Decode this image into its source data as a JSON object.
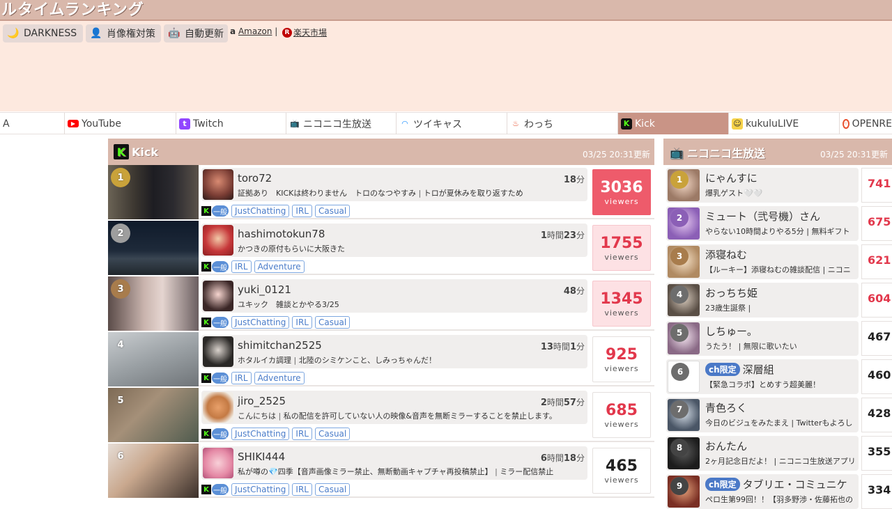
{
  "header": {
    "title": "ルタイムランキング",
    "buttons": [
      {
        "label": "DARKNESS",
        "icon": "moon-icon"
      },
      {
        "label": "肖像権対策",
        "icon": "portrait-icon"
      },
      {
        "label": "自動更新",
        "icon": "robot-icon"
      }
    ],
    "amazon": "Amazon",
    "separator": "|",
    "rakuten": "楽天市場",
    "amazon_mark": "a",
    "rakuten_mark": "R"
  },
  "tabs": [
    {
      "label": "A",
      "icon": ""
    },
    {
      "label": "YouTube",
      "icon": "youtube-icon"
    },
    {
      "label": "Twitch",
      "icon": "twitch-icon"
    },
    {
      "label": "ニコニコ生放送",
      "icon": "niconico-icon"
    },
    {
      "label": "ツイキャス",
      "icon": "twitcasting-icon"
    },
    {
      "label": "わっち",
      "icon": "watch-icon"
    },
    {
      "label": "Kick",
      "icon": "kick-icon"
    },
    {
      "label": "kukuluLIVE",
      "icon": "kukulu-icon"
    },
    {
      "label": "OPENRE",
      "icon": "openrec-icon"
    }
  ],
  "kick_panel": {
    "title": "Kick",
    "updated": "03/25 20:31更新",
    "general_label": "一般",
    "viewers_label": "viewers",
    "rows": [
      {
        "rank": "1",
        "name": "toro72",
        "desc": "証拠あり　KICKは終わりません　トロのなつやすみ",
        "desc2": "トロが夏休みを取り返すため",
        "duration_num": "18",
        "duration_unit": "分",
        "duration_num2": "",
        "duration_unit2": "",
        "tags": [
          "JustChatting",
          "IRL",
          "Casual"
        ],
        "viewers": "3036"
      },
      {
        "rank": "2",
        "name": "hashimotokun78",
        "desc": "かつきの原付もらいに大阪きた",
        "desc2": "",
        "duration_num": "1",
        "duration_unit": "時間",
        "duration_num2": "23",
        "duration_unit2": "分",
        "tags": [
          "IRL",
          "Adventure"
        ],
        "viewers": "1755"
      },
      {
        "rank": "3",
        "name": "yuki_0121",
        "desc": "ユキック　雑談とかやる3/25",
        "desc2": "",
        "duration_num": "48",
        "duration_unit": "分",
        "duration_num2": "",
        "duration_unit2": "",
        "tags": [
          "JustChatting",
          "IRL",
          "Casual"
        ],
        "viewers": "1345"
      },
      {
        "rank": "4",
        "name": "shimitchan2525",
        "desc": "ホタルイカ調理",
        "desc2": "北陸のシミケンこと、しみっちゃんだ！",
        "duration_num": "13",
        "duration_unit": "時間",
        "duration_num2": "1",
        "duration_unit2": "分",
        "tags": [
          "IRL",
          "Adventure"
        ],
        "viewers": "925"
      },
      {
        "rank": "5",
        "name": "jiro_2525",
        "desc": "こんにちは",
        "desc2": "私の配信を許可していない人の映像&音声を無断ミラーすることを禁止します。",
        "duration_num": "2",
        "duration_unit": "時間",
        "duration_num2": "57",
        "duration_unit2": "分",
        "tags": [
          "JustChatting",
          "IRL",
          "Casual"
        ],
        "viewers": "685"
      },
      {
        "rank": "6",
        "name": "SHIKI444",
        "desc": "私が噂の💎四季【音声画像ミラー禁止、無断動画キャプチャ再投稿禁止】",
        "desc2": "ミラー配信禁止",
        "duration_num": "6",
        "duration_unit": "時間",
        "duration_num2": "18",
        "duration_unit2": "分",
        "tags": [
          "JustChatting",
          "IRL",
          "Casual"
        ],
        "viewers": "465"
      }
    ]
  },
  "nico_panel": {
    "title": "ニコニコ生放送",
    "updated": "03/25 20:31更新",
    "ch_label": "ch限定",
    "rows": [
      {
        "rank": "1",
        "title": "にゃんすに",
        "desc": "爆乳ゲスト🤍🤍",
        "viewers": "741",
        "ch": false
      },
      {
        "rank": "2",
        "title": "ミュート（弐号機）さん",
        "desc": "やらない10時間よりやる5分 | 無料ギフト",
        "viewers": "675",
        "ch": false
      },
      {
        "rank": "3",
        "title": "添寝ねむ",
        "desc": "【ルーキー】添寝ねむの雑談配信 | ニコニ",
        "viewers": "621",
        "ch": false
      },
      {
        "rank": "4",
        "title": "おっちち姫",
        "desc": "23歳生誕祭 |",
        "viewers": "604",
        "ch": false
      },
      {
        "rank": "5",
        "title": "しちゅー。",
        "desc": "うたう！ | 無限に歌いたい",
        "viewers": "467",
        "ch": false
      },
      {
        "rank": "6",
        "title": "深層組",
        "desc": "【緊急コラボ】とめすう超美麗！",
        "viewers": "460",
        "ch": true
      },
      {
        "rank": "7",
        "title": "青色ろく",
        "desc": "今日のビジュをみたまえ | Twitterもよろし",
        "viewers": "428",
        "ch": false
      },
      {
        "rank": "8",
        "title": "おんたん",
        "desc": "2ヶ月記念日だよ！ | ニコニコ生放送アプリ",
        "viewers": "355",
        "ch": false
      },
      {
        "rank": "9",
        "title": "タブリエ・コミュニケ",
        "desc": "ペロ生第99回！！【羽多野渉・佐藤拓也の",
        "viewers": "334",
        "ch": true
      }
    ]
  }
}
